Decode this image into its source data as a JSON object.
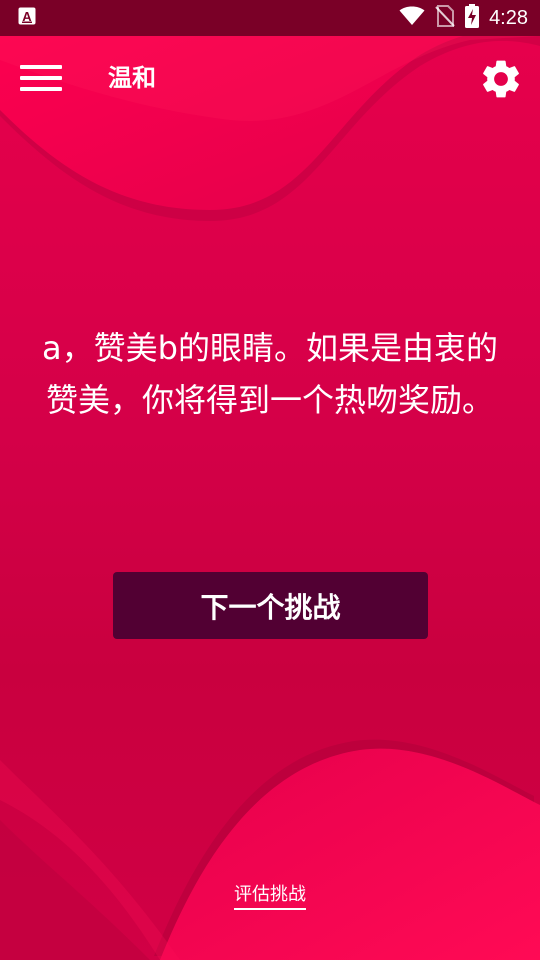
{
  "status_bar": {
    "time": "4:28",
    "icons": [
      "app-a-icon",
      "wifi-icon",
      "no-sim-icon",
      "battery-charging-icon"
    ]
  },
  "app_bar": {
    "title": "温和",
    "menu_icon": "hamburger-menu-icon",
    "settings_icon": "gear-icon"
  },
  "challenge": {
    "text": "a，赞美b的眼睛。如果是由衷的赞美，你将得到一个热吻奖励。"
  },
  "next_button": {
    "label": "下一个挑战"
  },
  "rate_link": {
    "label": "评估挑战"
  },
  "colors": {
    "background": "#d6004a",
    "status_bar": "#7a0027",
    "button": "#520033",
    "text": "#ffffff"
  }
}
